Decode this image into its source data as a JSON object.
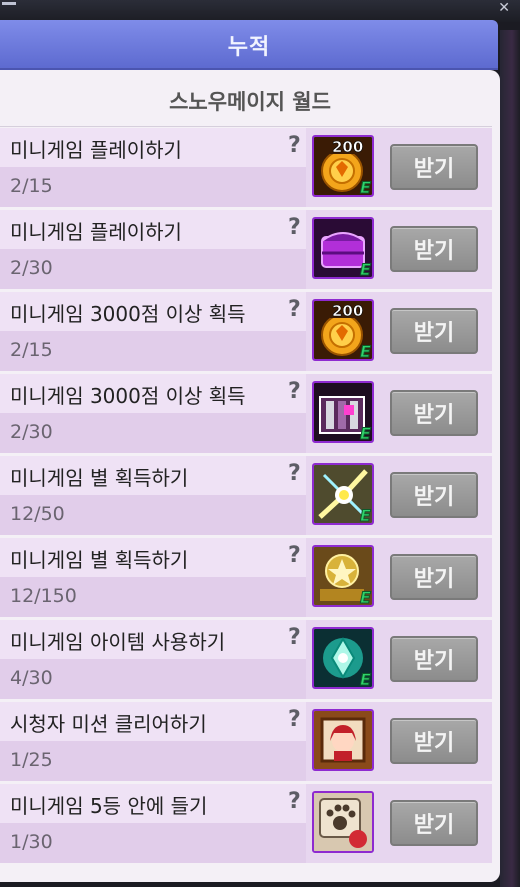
{
  "header": {
    "title": "누적"
  },
  "world": {
    "name": "스노우메이지 월드"
  },
  "missions": [
    {
      "title": "미니게임 플레이하기",
      "progress": "2/15",
      "reward_icon": "coin-200-icon",
      "reward_badge": "200",
      "claim_label": "받기"
    },
    {
      "title": "미니게임 플레이하기",
      "progress": "2/30",
      "reward_icon": "purple-box-icon",
      "reward_badge": "",
      "claim_label": "받기"
    },
    {
      "title": "미니게임 3000점 이상 획득",
      "progress": "2/15",
      "reward_icon": "coin-200-icon",
      "reward_badge": "200",
      "claim_label": "받기"
    },
    {
      "title": "미니게임 3000점 이상 획득",
      "progress": "2/30",
      "reward_icon": "pink-chest-icon",
      "reward_badge": "",
      "claim_label": "받기"
    },
    {
      "title": "미니게임 별 획득하기",
      "progress": "12/50",
      "reward_icon": "sparkle-burst-icon",
      "reward_badge": "",
      "claim_label": "받기"
    },
    {
      "title": "미니게임 별 획득하기",
      "progress": "12/150",
      "reward_icon": "gold-emblem-icon",
      "reward_badge": "",
      "claim_label": "받기"
    },
    {
      "title": "미니게임 아이템 사용하기",
      "progress": "4/30",
      "reward_icon": "teal-crystal-icon",
      "reward_badge": "",
      "claim_label": "받기"
    },
    {
      "title": "시청자 미션 클리어하기",
      "progress": "1/25",
      "reward_icon": "character-portrait-icon",
      "reward_badge": "",
      "claim_label": "받기"
    },
    {
      "title": "미니게임 5등 안에 들기",
      "progress": "1/30",
      "reward_icon": "paw-item-icon",
      "reward_badge": "",
      "claim_label": "받기"
    }
  ],
  "help_glyph": "?",
  "item_mark": "E",
  "colors": {
    "header": "#6f7be0",
    "panel": "#f4f0f6",
    "row_light": "#efe2f5",
    "row_dark": "#e1cdea",
    "button": "#999999",
    "icon_border": "#8e2ad0"
  }
}
